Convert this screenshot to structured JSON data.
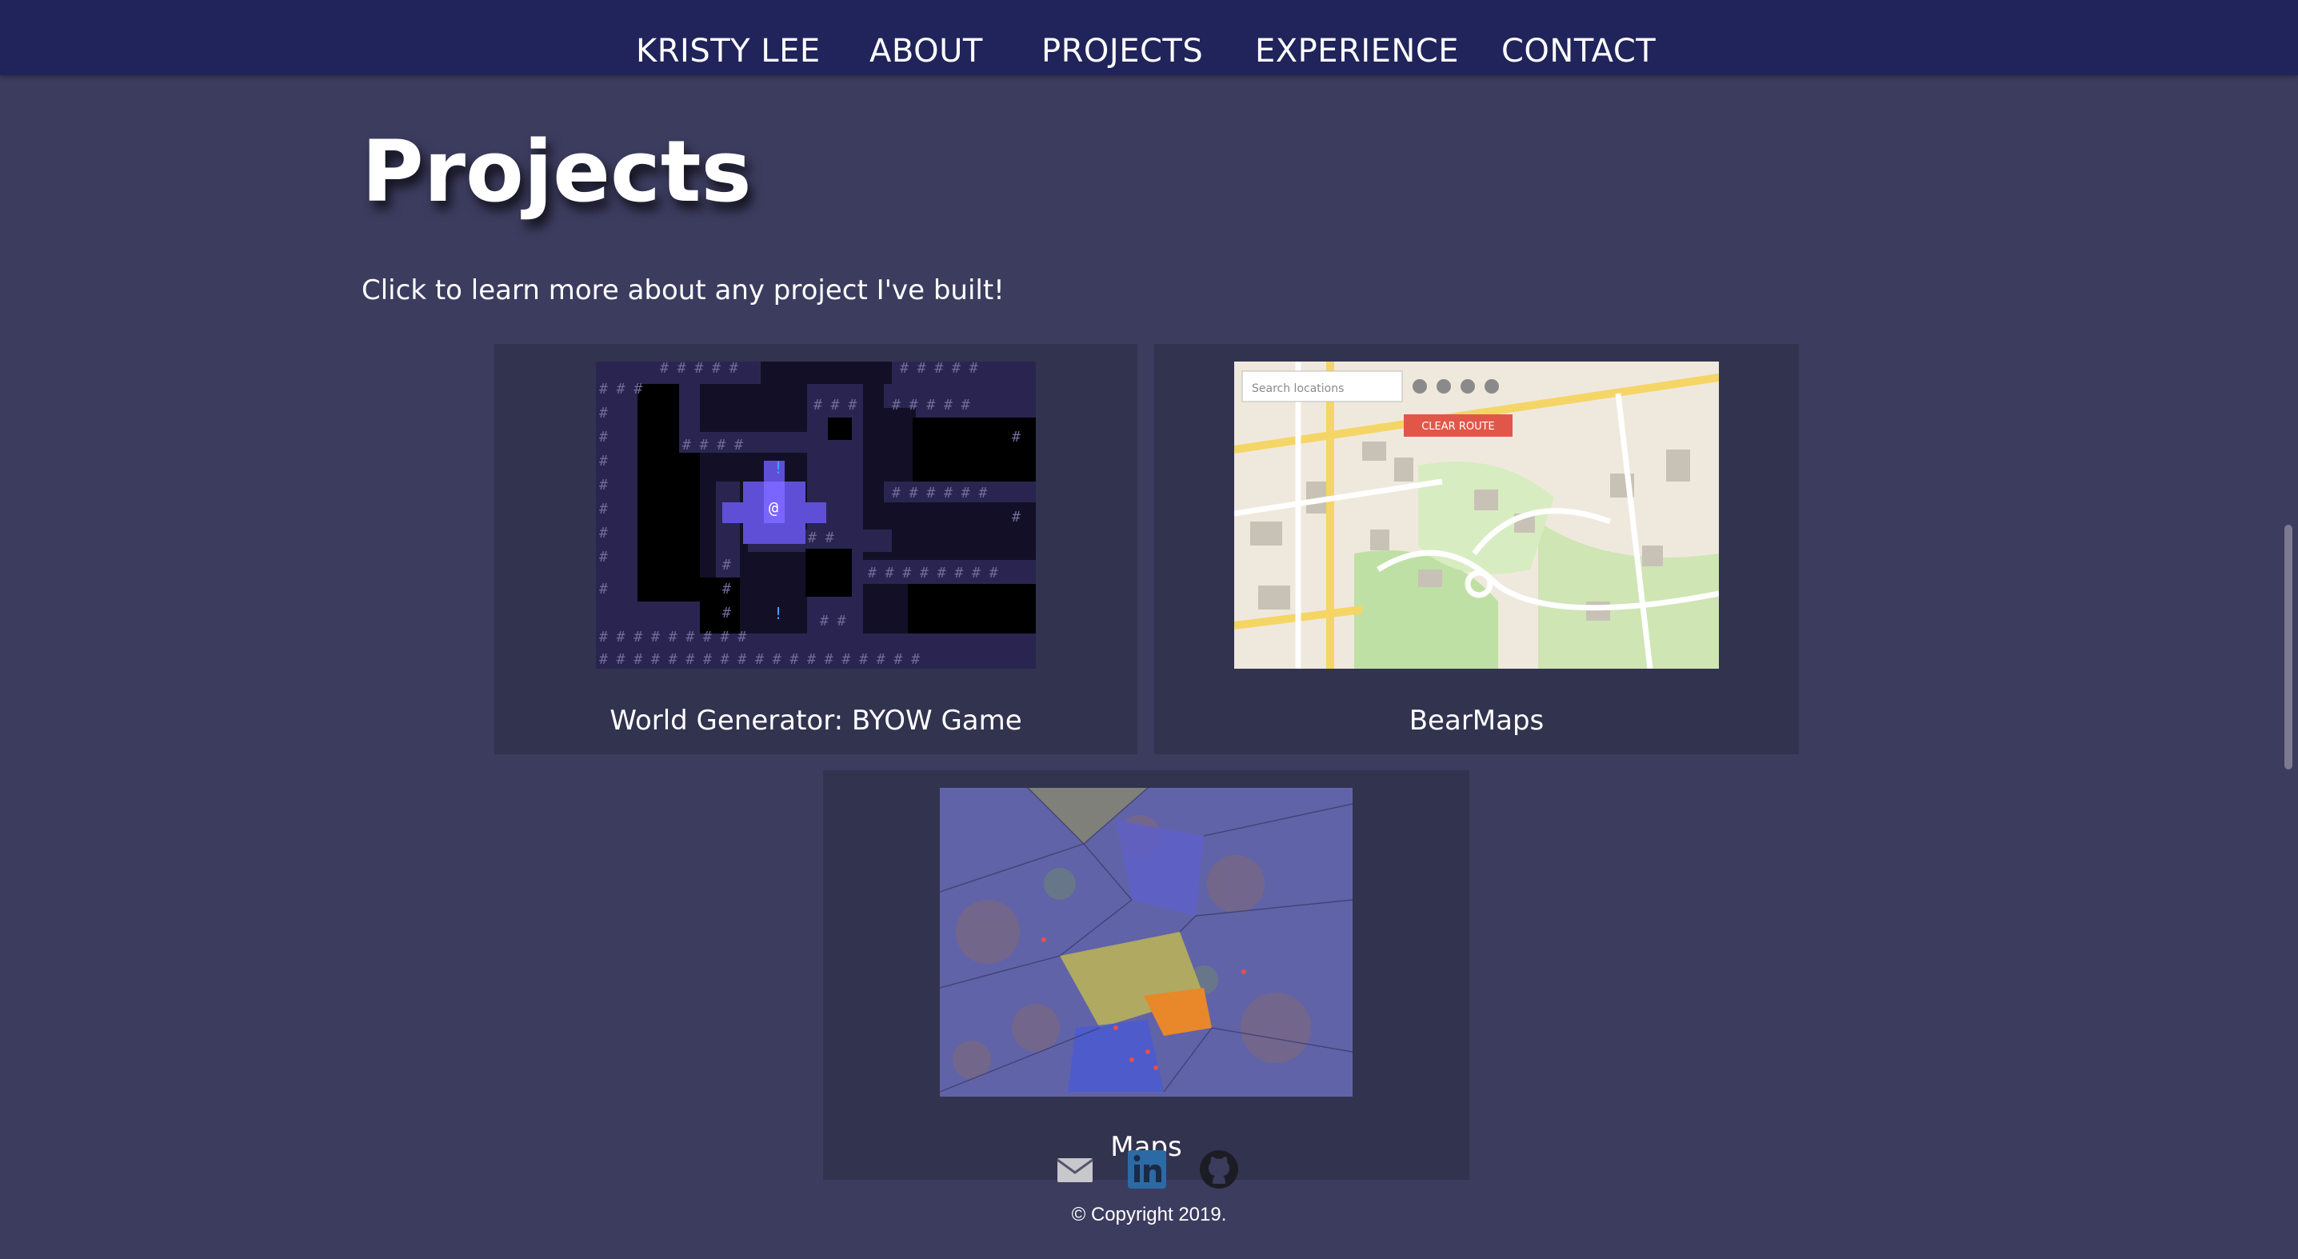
{
  "nav": {
    "brand": "KRISTY LEE",
    "items": [
      "ABOUT",
      "PROJECTS",
      "EXPERIENCE",
      "CONTACT"
    ]
  },
  "page": {
    "title": "Projects",
    "intro": "Click to learn more about any project I've built!"
  },
  "projects": [
    {
      "title": "World Generator: BYOW Game",
      "thumbnail": "tile-world-game-screenshot"
    },
    {
      "title": "BearMaps",
      "thumbnail": "campus-map-screenshot"
    },
    {
      "title": "Maps",
      "thumbnail": "voronoi-map-screenshot"
    }
  ],
  "map": {
    "search_placeholder": "Search locations",
    "clear_route": "CLEAR ROUTE"
  },
  "footer": {
    "icons": [
      "email-icon",
      "linkedin-icon",
      "github-icon"
    ],
    "copyright": "© Copyright 2019."
  },
  "colors": {
    "background": "#3c3c5f",
    "navbar": "#20245a",
    "card": "#32334f",
    "game_player": "#7a66ff",
    "map_button": "#e0574a"
  }
}
